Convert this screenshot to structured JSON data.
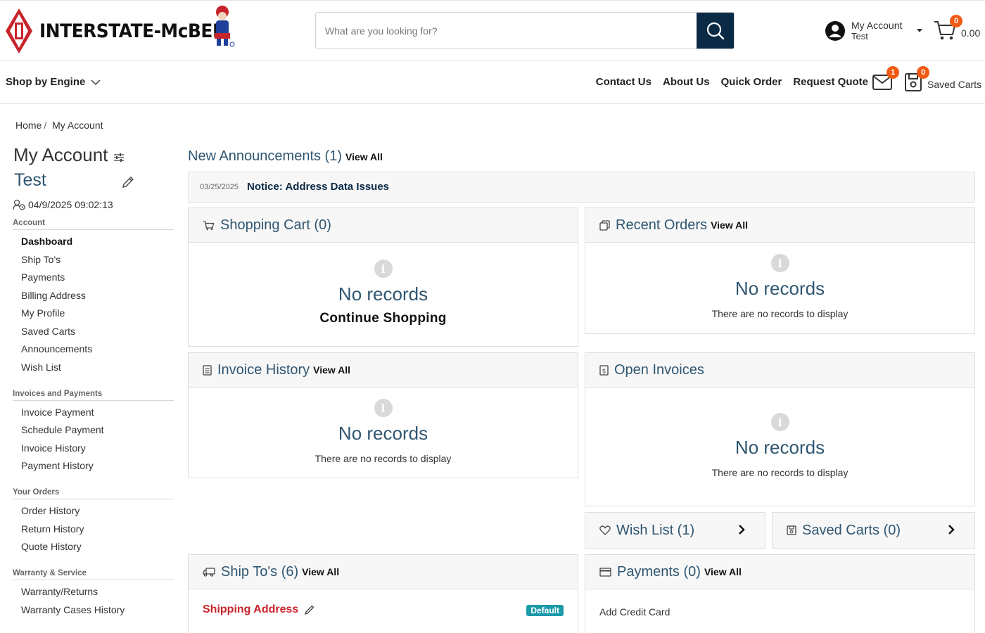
{
  "brand": {
    "name": "INTERSTATE-McBEE"
  },
  "search": {
    "placeholder": "What are you looking for?"
  },
  "account": {
    "label": "My Account",
    "user": "Test"
  },
  "cart": {
    "count": "0",
    "total": "0.00"
  },
  "nav": {
    "shop_by_engine": "Shop by Engine",
    "links": [
      "Contact Us",
      "About Us",
      "Quick Order",
      "Request Quote"
    ],
    "mail_count": "1",
    "saved_carts_count": "0",
    "saved_carts_label": "Saved Carts"
  },
  "breadcrumb": {
    "home": "Home",
    "sep": "/",
    "current": "My Account"
  },
  "sidebar": {
    "title": "My Account",
    "user": "Test",
    "last_login": "04/9/2025 09:02:13",
    "sections": [
      {
        "label": "Account",
        "items": [
          "Dashboard",
          "Ship To's",
          "Payments",
          "Billing Address",
          "My Profile",
          "Saved Carts",
          "Announcements",
          "Wish List"
        ]
      },
      {
        "label": "Invoices and Payments",
        "items": [
          "Invoice Payment",
          "Schedule Payment",
          "Invoice History",
          "Payment History"
        ]
      },
      {
        "label": "Your Orders",
        "items": [
          "Order History",
          "Return History",
          "Quote History"
        ]
      },
      {
        "label": "Warranty & Service",
        "items": [
          "Warranty/Returns",
          "Warranty Cases History"
        ]
      }
    ]
  },
  "announcements": {
    "title": "New Announcements (1)",
    "view_all": "View All",
    "date": "03/25/2025",
    "text": "Notice: Address Data Issues"
  },
  "cards": {
    "shopping_cart": {
      "title": "Shopping Cart (0)",
      "empty": "No records",
      "action": "Continue Shopping"
    },
    "recent_orders": {
      "title": "Recent Orders",
      "view_all": "View All",
      "empty": "No records",
      "sub": "There are no records to display"
    },
    "invoice_history": {
      "title": "Invoice History",
      "view_all": "View All",
      "empty": "No records",
      "sub": "There are no records to display"
    },
    "open_invoices": {
      "title": "Open Invoices",
      "empty": "No records",
      "sub": "There are no records to display"
    },
    "wish_list": {
      "title": "Wish List (1)"
    },
    "saved_carts": {
      "title": "Saved Carts (0)"
    },
    "ship_tos": {
      "title": "Ship To's (6)",
      "view_all": "View All",
      "address_label": "Shipping Address",
      "badge": "Default"
    },
    "payments": {
      "title": "Payments (0)",
      "view_all": "View All",
      "add_card": "Add Credit Card"
    }
  },
  "colors": {
    "navy": "#0b2a45",
    "heading_blue": "#2f5671",
    "badge_orange": "#f25a13",
    "brand_red": "#c8242b",
    "default_teal": "#1b9aaa"
  }
}
